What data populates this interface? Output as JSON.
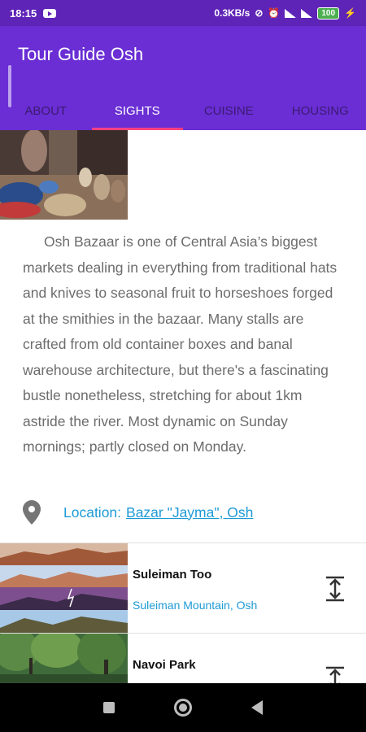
{
  "status": {
    "time": "18:15",
    "speed": "0.3KB/s",
    "battery": "100"
  },
  "app": {
    "title": "Tour Guide Osh"
  },
  "tabs": [
    {
      "label": "ABOUT",
      "active": false
    },
    {
      "label": "SIGHTS",
      "active": true
    },
    {
      "label": "CUISINE",
      "active": false
    },
    {
      "label": "HOUSING",
      "active": false
    }
  ],
  "detail": {
    "description": "Osh Bazaar is one of Central Asia’s biggest markets dealing in everything from traditional hats and knives to seasonal fruit to horseshoes forged at the smithies in the bazaar. Many stalls are crafted from old container boxes and banal warehouse architecture, but there's a fascinating bustle nonetheless, stretching for about 1km astride the river. Most dynamic on Sunday mornings; partly closed on Monday.",
    "location_label": "Location:",
    "location_link": "Bazar \"Jayma\", Osh"
  },
  "list": [
    {
      "title": "Suleiman Too",
      "subtitle": "Suleiman Mountain, Osh"
    },
    {
      "title": "Navoi Park",
      "subtitle": ""
    }
  ],
  "colors": {
    "status_bar": "#5e23b7",
    "app_bar": "#6a2ed4",
    "tab_indicator": "#ff4081",
    "link": "#1e9ad6"
  }
}
